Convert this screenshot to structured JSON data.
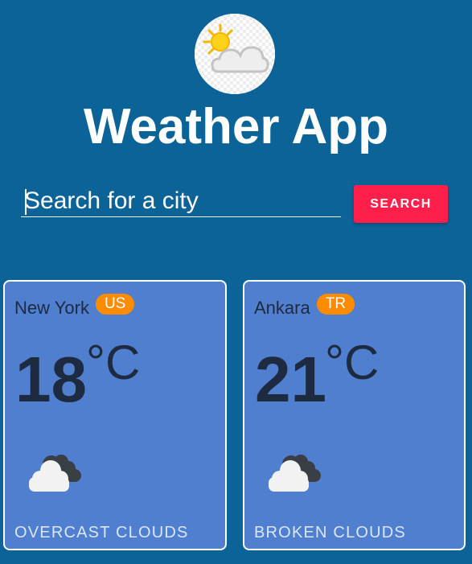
{
  "app": {
    "title": "Weather App",
    "logo_icon": "sun-behind-cloud-icon"
  },
  "search": {
    "placeholder": "Search for a city",
    "value": "",
    "button_label": "SEARCH"
  },
  "colors": {
    "background": "#0b6397",
    "card": "#4f7fce",
    "search_button": "#ff1f4b",
    "country_badge": "#ff8c00"
  },
  "cards": [
    {
      "city": "New York",
      "country": "US",
      "temperature": "18",
      "unit": "°C",
      "icon": "broken-clouds-icon",
      "description": "OVERCAST CLOUDS"
    },
    {
      "city": "Ankara",
      "country": "TR",
      "temperature": "21",
      "unit": "°C",
      "icon": "broken-clouds-icon",
      "description": "BROKEN CLOUDS"
    }
  ]
}
